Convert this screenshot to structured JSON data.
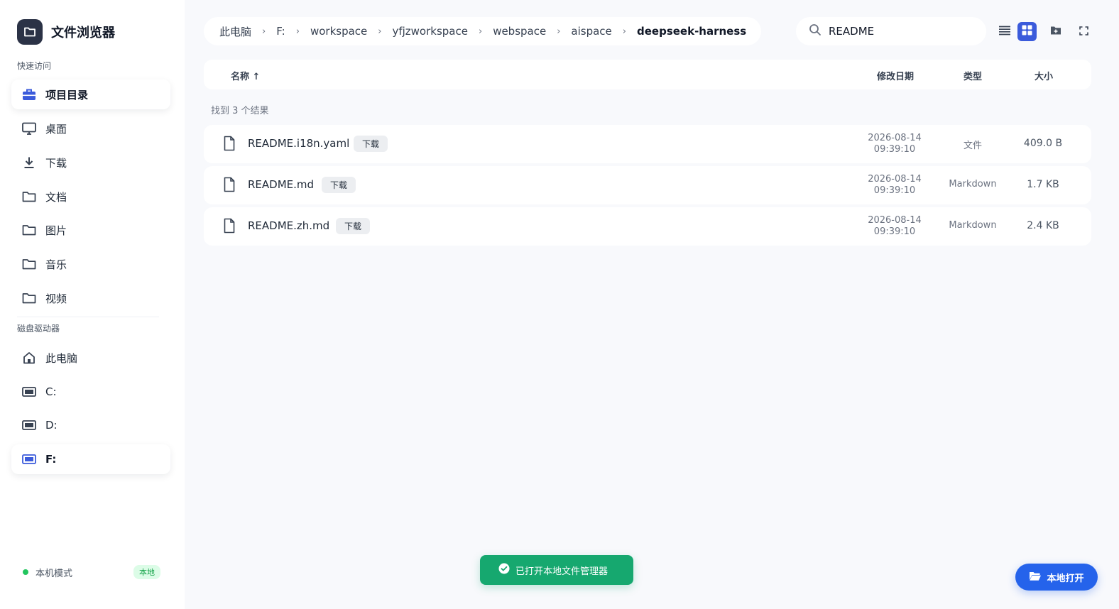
{
  "app": {
    "title": "文件浏览器"
  },
  "sidebar": {
    "quick_access_label": "快速访问",
    "quick_access": [
      {
        "label": "项目目录",
        "icon": "briefcase-icon",
        "active": true
      },
      {
        "label": "桌面",
        "icon": "monitor-icon"
      },
      {
        "label": "下载",
        "icon": "download-icon"
      },
      {
        "label": "文档",
        "icon": "folder-icon"
      },
      {
        "label": "图片",
        "icon": "folder-icon"
      },
      {
        "label": "音乐",
        "icon": "folder-icon"
      },
      {
        "label": "视频",
        "icon": "folder-icon"
      }
    ],
    "drives_label": "磁盘驱动器",
    "drives": [
      {
        "label": "此电脑",
        "icon": "home-icon"
      },
      {
        "label": "C:",
        "icon": "drive-icon"
      },
      {
        "label": "D:",
        "icon": "drive-icon"
      },
      {
        "label": "F:",
        "icon": "drive-icon",
        "active": true
      }
    ],
    "mode": {
      "label": "本机模式",
      "badge": "本地",
      "status_color": "#22c55e"
    }
  },
  "breadcrumb": [
    "此电脑",
    "F:",
    "workspace",
    "yfjzworkspace",
    "webspace",
    "aispace",
    "deepseek-harness"
  ],
  "search": {
    "value": "README",
    "icon": "search-icon"
  },
  "toolbar": {
    "icons": [
      "list-view-icon",
      "grid-view-icon",
      "new-folder-icon",
      "fullscreen-icon"
    ],
    "active": "grid-view-icon"
  },
  "table": {
    "headers": {
      "name": "名称 ↑",
      "date": "修改日期",
      "type": "类型",
      "size": "大小"
    },
    "result_count": "找到 3 个结果",
    "download_label": "下载",
    "rows": [
      {
        "name": "README.i18n.yaml",
        "date": "2026-08-14",
        "time": "09:39:10",
        "type": "文件",
        "size": "409.0 B"
      },
      {
        "name": "README.md",
        "date": "2026-08-14",
        "time": "09:39:10",
        "type": "Markdown",
        "size": "1.7 KB"
      },
      {
        "name": "README.zh.md",
        "date": "2026-08-14",
        "time": "09:39:10",
        "type": "Markdown",
        "size": "2.4 KB"
      }
    ]
  },
  "toast": {
    "text": "已打开本地文件管理器",
    "icon": "check-circle-icon"
  },
  "open_local": {
    "label": "本地打开",
    "icon": "folder-open-icon"
  },
  "colors": {
    "accent": "#3b5bdb",
    "toast": "#16a86f",
    "fab": "#2563eb"
  }
}
